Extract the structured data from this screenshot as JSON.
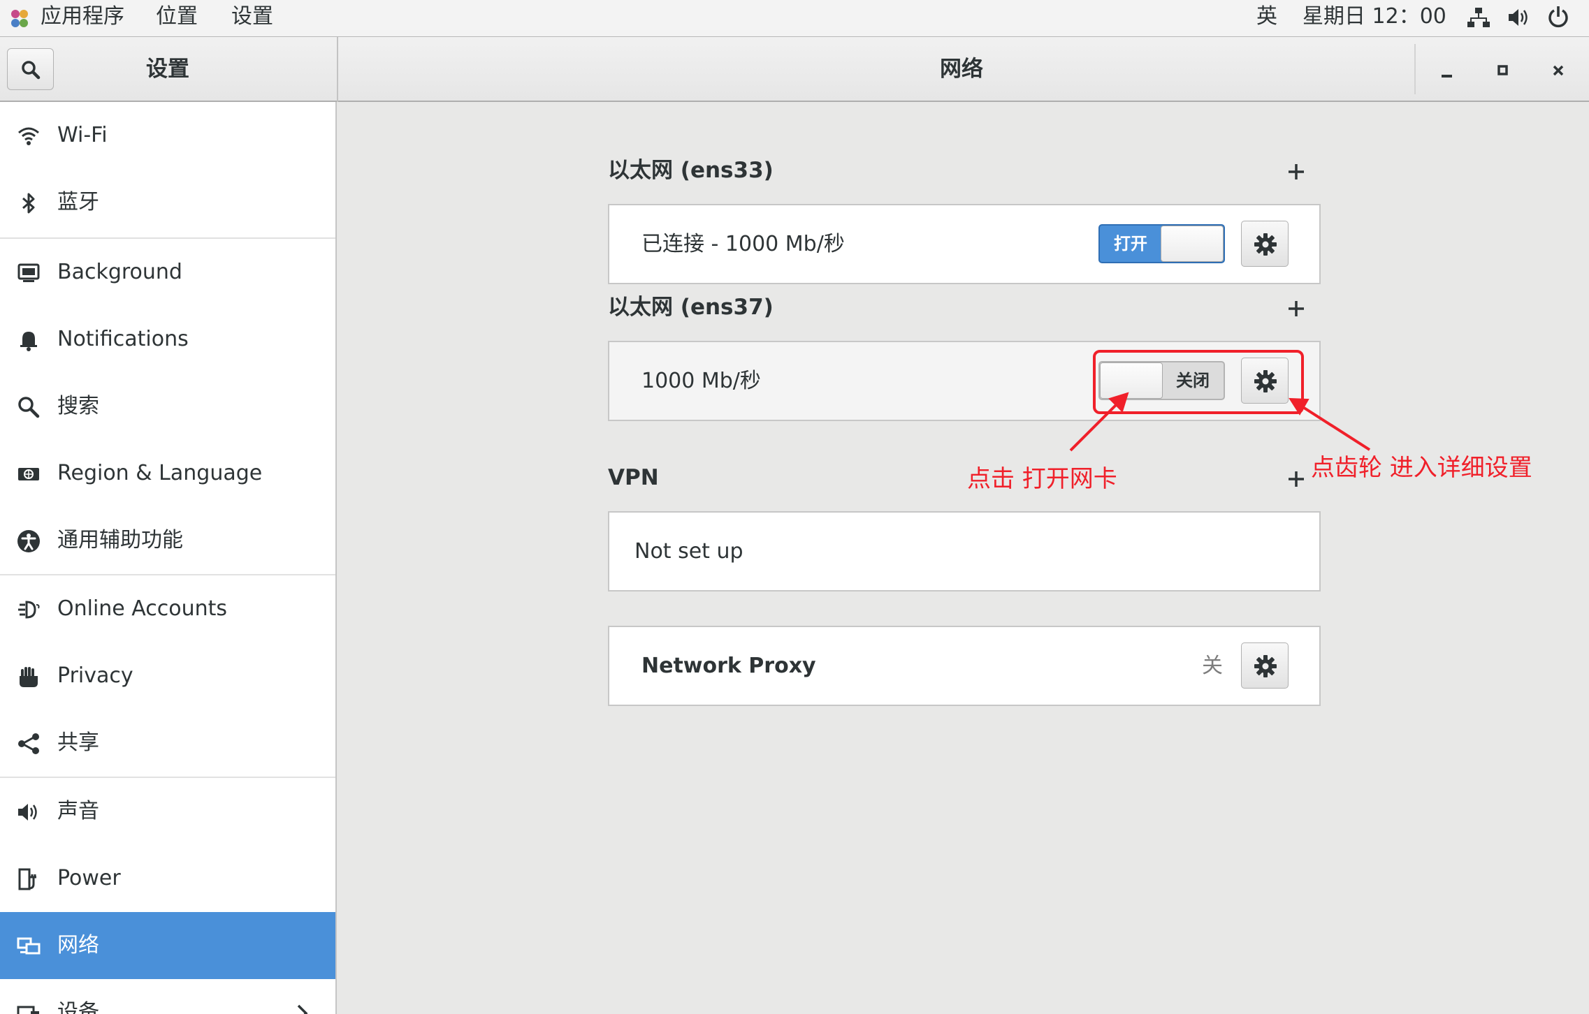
{
  "top_panel": {
    "apps_menu": "应用程序",
    "places_menu": "位置",
    "settings_menu": "设置",
    "input_method": "英",
    "clock": "星期日 12：00"
  },
  "header": {
    "sidebar_title": "设置",
    "content_title": "网络"
  },
  "sidebar": {
    "items": [
      {
        "label": "Wi-Fi",
        "icon": "wifi-icon"
      },
      {
        "label": "蓝牙",
        "icon": "bluetooth-icon"
      },
      {
        "label": "Background",
        "icon": "background-icon"
      },
      {
        "label": "Notifications",
        "icon": "bell-icon"
      },
      {
        "label": "搜索",
        "icon": "search-icon"
      },
      {
        "label": "Region & Language",
        "icon": "region-icon"
      },
      {
        "label": "通用辅助功能",
        "icon": "accessibility-icon"
      },
      {
        "label": "Online Accounts",
        "icon": "online-accounts-icon"
      },
      {
        "label": "Privacy",
        "icon": "hand-icon"
      },
      {
        "label": "共享",
        "icon": "share-icon"
      },
      {
        "label": "声音",
        "icon": "speaker-icon"
      },
      {
        "label": "Power",
        "icon": "power-plug-icon"
      },
      {
        "label": "网络",
        "icon": "network-icon",
        "active": true
      },
      {
        "label": "设备",
        "icon": "devices-icon"
      }
    ]
  },
  "network": {
    "ethernet1": {
      "title": "以太网 (ens33)",
      "status": "已连接 - 1000  Mb/秒",
      "switch_label": "打开",
      "switch_on": true
    },
    "ethernet2": {
      "title": "以太网 (ens37)",
      "status": "1000 Mb/秒",
      "switch_label": "关闭",
      "switch_on": false
    },
    "vpn": {
      "title": "VPN",
      "status": "Not set up"
    },
    "proxy": {
      "title": "Network Proxy",
      "status": "关"
    }
  },
  "annotations": {
    "switch_hint": "点击 打开网卡",
    "gear_hint": "点齿轮 进入详细设置",
    "color": "#f0202a"
  },
  "colors": {
    "accent": "#4a90d9",
    "annotation": "#f0202a"
  }
}
